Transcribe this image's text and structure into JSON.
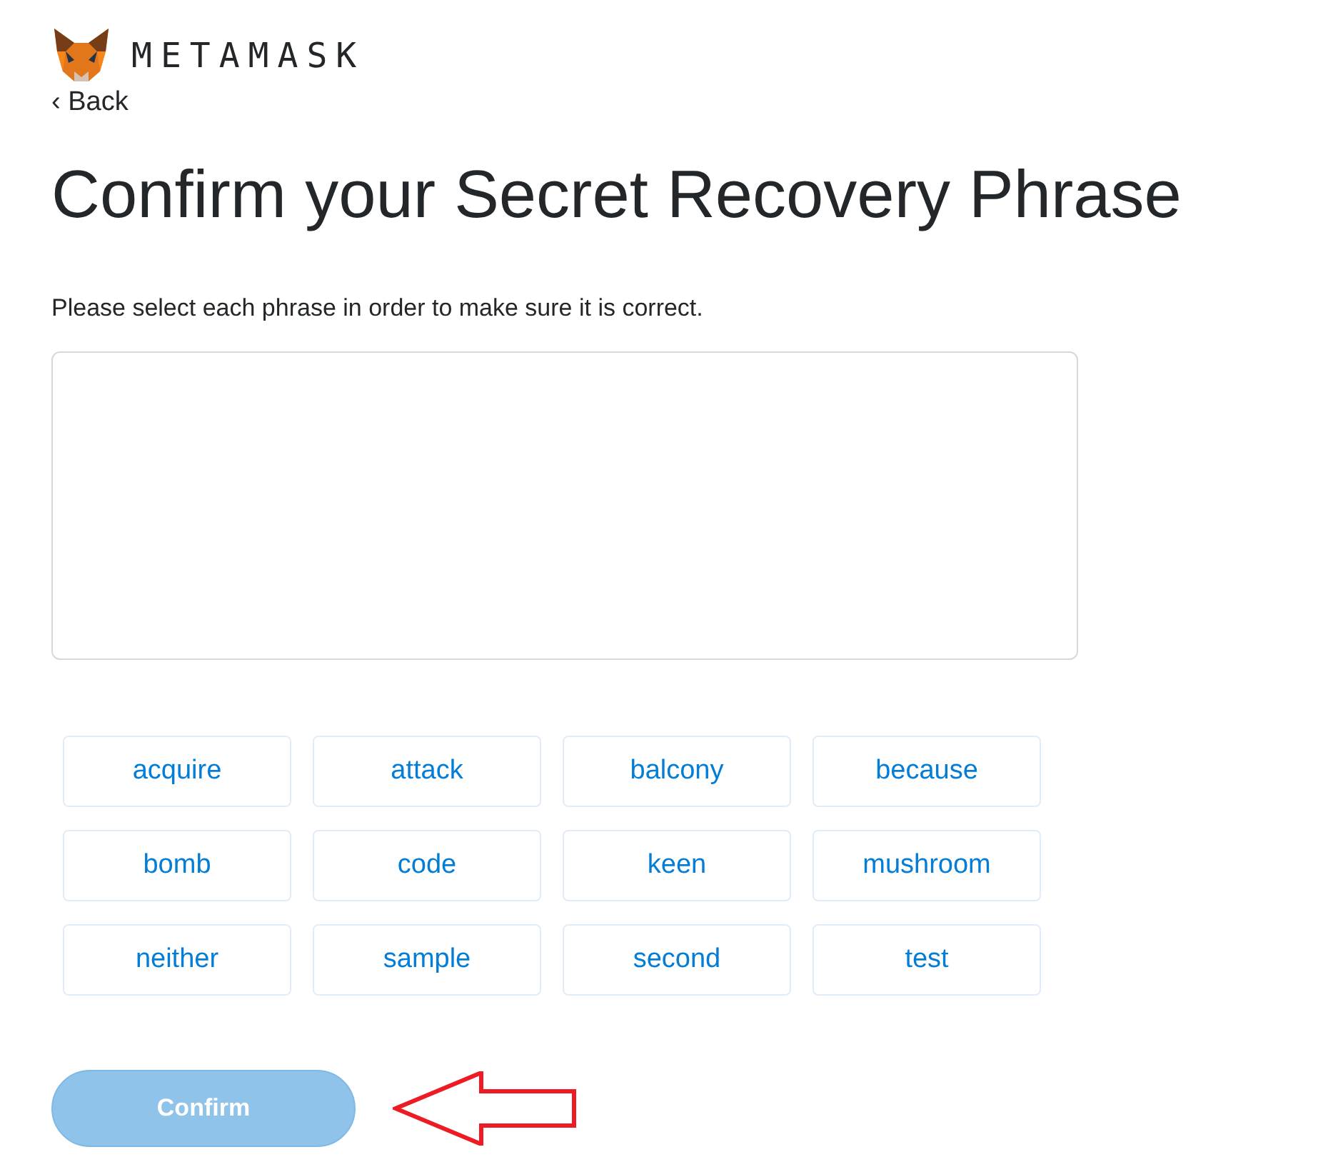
{
  "brand": {
    "name": "METAMASK"
  },
  "back_link": "‹ Back",
  "title": "Confirm your Secret Recovery Phrase",
  "instructions": "Please select each phrase in order to make sure it is correct.",
  "words": [
    {
      "label": "acquire",
      "selected": false
    },
    {
      "label": "attack",
      "selected": false
    },
    {
      "label": "balcony",
      "selected": false
    },
    {
      "label": "because",
      "selected": false
    },
    {
      "label": "bomb",
      "selected": false
    },
    {
      "label": "code",
      "selected": false
    },
    {
      "label": "keen",
      "selected": false
    },
    {
      "label": "mushroom",
      "selected": false
    },
    {
      "label": "neither",
      "selected": false
    },
    {
      "label": "sample",
      "selected": false
    },
    {
      "label": "second",
      "selected": false
    },
    {
      "label": "test",
      "selected": false
    }
  ],
  "confirm_button": {
    "label": "Confirm",
    "disabled": true
  }
}
